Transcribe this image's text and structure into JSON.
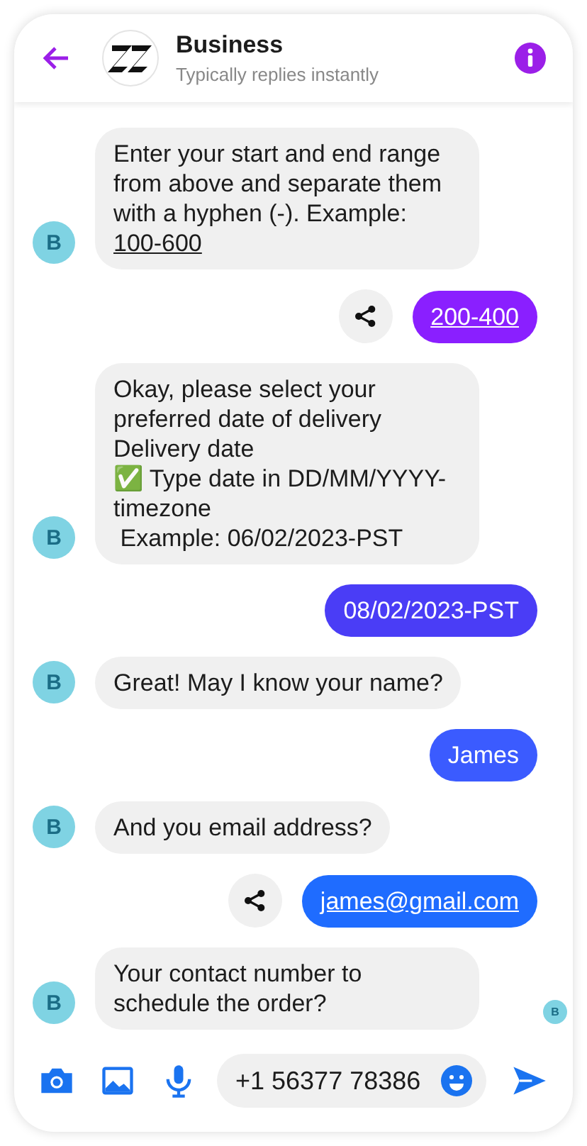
{
  "header": {
    "title": "Business",
    "subtitle": "Typically replies instantly"
  },
  "messages": [
    {
      "kind": "incoming",
      "avatar": "B",
      "text": "Enter your start and end range from above and separate them with a hyphen (-). Example:",
      "link": "100-600"
    },
    {
      "kind": "outgoing",
      "text": "200-400",
      "link": true,
      "share": true,
      "color": "#8a1fff"
    },
    {
      "kind": "incoming",
      "avatar": "B",
      "text": "Okay, please select your preferred date of delivery\nDelivery date\n✅ Type date in DD/MM/YYYY-timezone\n Example: 06/02/2023-PST"
    },
    {
      "kind": "outgoing",
      "text": "08/02/2023-PST",
      "link": false,
      "share": false,
      "color": "#4a3df6"
    },
    {
      "kind": "incoming",
      "avatar": "B",
      "text": "Great! May I know your name?"
    },
    {
      "kind": "outgoing",
      "text": "James",
      "link": false,
      "share": false,
      "color": "#3b5bff"
    },
    {
      "kind": "incoming",
      "avatar": "B",
      "text": "And you email address?"
    },
    {
      "kind": "outgoing",
      "text": "james@gmail.com",
      "link": true,
      "share": true,
      "color": "#1f6cff"
    },
    {
      "kind": "incoming",
      "avatar": "B",
      "text": "Your contact number to schedule the order?"
    }
  ],
  "seen": {
    "letter": "B"
  },
  "composer": {
    "value": "+1 56377 78386"
  }
}
